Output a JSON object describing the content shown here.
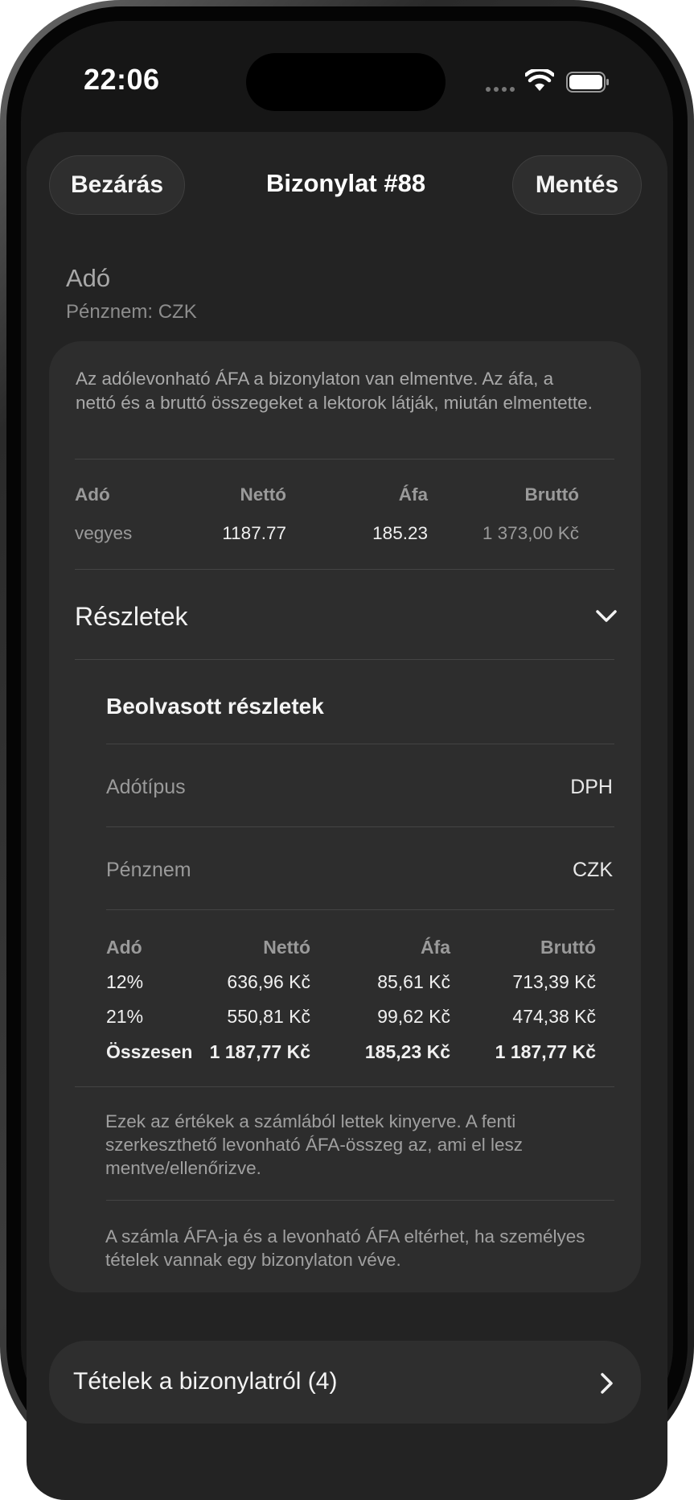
{
  "status_bar": {
    "time": "22:06"
  },
  "nav": {
    "close_label": "Bezárás",
    "title": "Bizonylat #88",
    "save_label": "Mentés"
  },
  "tax_section": {
    "title": "Adó",
    "currency_line": "Pénznem: CZK",
    "info": "Az adólevonható ÁFA a bizonylaton van elmentve. Az áfa, a nettó és a bruttó összegeket a lektorok látják, miután elmentette.",
    "table": {
      "headers": [
        "Adó",
        "Nettó",
        "Áfa",
        "Bruttó"
      ],
      "row": [
        "vegyes",
        "1187.77",
        "185.23",
        "1 373,00 Kč"
      ]
    }
  },
  "details": {
    "title": "Részletek",
    "scanned_title": "Beolvasott részletek",
    "tax_type_label": "Adótípus",
    "tax_type_value": "DPH",
    "currency_label": "Pénznem",
    "currency_value": "CZK",
    "table": {
      "headers": [
        "Adó",
        "Nettó",
        "Áfa",
        "Bruttó"
      ],
      "rows": [
        [
          "12%",
          "636,96 Kč",
          "85,61 Kč",
          "713,39 Kč"
        ],
        [
          "21%",
          "550,81 Kč",
          "99,62 Kč",
          "474,38 Kč"
        ]
      ],
      "total": [
        "Összesen",
        "1 187,77 Kč",
        "185,23 Kč",
        "1 187,77 Kč"
      ]
    },
    "note1": "Ezek az értékek a számlából lettek kinyerve. A fenti szerkeszthető levonható ÁFA-összeg az, ami el lesz mentve/ellenőrizve.",
    "note2": "A számla ÁFA-ja és a levonható ÁFA eltérhet, ha személyes tételek vannak egy bizonylaton véve."
  },
  "items_link": {
    "label": "Tételek a bizonylatról (4)"
  },
  "icons": {
    "wifi": "wifi-icon",
    "battery": "battery-icon",
    "chevron_down": "chevron-down-icon",
    "chevron_right": "chevron-right-icon"
  }
}
